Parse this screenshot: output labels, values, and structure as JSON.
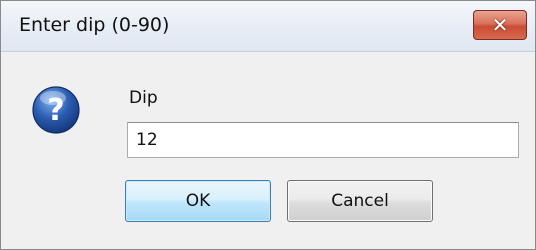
{
  "dialog": {
    "title": "Enter dip (0-90)",
    "close_glyph": "✕"
  },
  "prompt": {
    "icon": "question-icon",
    "label": "Dip",
    "input_value": "12"
  },
  "buttons": {
    "ok_label": "OK",
    "cancel_label": "Cancel"
  },
  "colors": {
    "close_button": "#c94d33",
    "ok_button_border": "#3c7fb1",
    "question_icon": "#2a5db0"
  }
}
